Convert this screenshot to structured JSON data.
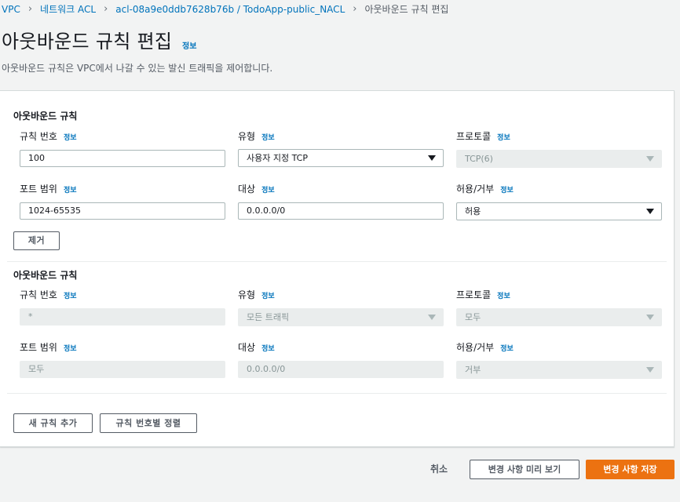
{
  "breadcrumb": {
    "items": [
      "VPC",
      "네트워크 ACL",
      "acl-08a9e0ddb7628b76b / TodoApp-public_NACL"
    ],
    "current": "아웃바운드 규칙 편집"
  },
  "header": {
    "title": "아웃바운드 규칙 편집",
    "info": "정보",
    "description": "아웃바운드 규칙은 VPC에서 나갈 수 있는 발신 트래픽을 제어합니다."
  },
  "labels": {
    "section": "아웃바운드 규칙",
    "rule_number": "규칙 번호",
    "type": "유형",
    "protocol": "프로토콜",
    "port_range": "포트 범위",
    "destination": "대상",
    "allow_deny": "허용/거부",
    "info": "정보"
  },
  "rules": [
    {
      "rule_number": "100",
      "type": "사용자 지정 TCP",
      "protocol": "TCP(6)",
      "port_range": "1024-65535",
      "destination": "0.0.0.0/0",
      "allow_deny": "허용",
      "remove_label": "제거"
    },
    {
      "rule_number": "*",
      "type": "모든 트래픽",
      "protocol": "모두",
      "port_range": "모두",
      "destination": "0.0.0.0/0",
      "allow_deny": "거부"
    }
  ],
  "actions": {
    "add_rule": "새 규칙 추가",
    "sort_by_number": "규칙 번호별 정렬",
    "cancel": "취소",
    "preview": "변경 사항 미리 보기",
    "save": "변경 사항 저장"
  },
  "colors": {
    "link": "#0073bb",
    "primary": "#ec7211",
    "disabled_bg": "#eaeded"
  }
}
